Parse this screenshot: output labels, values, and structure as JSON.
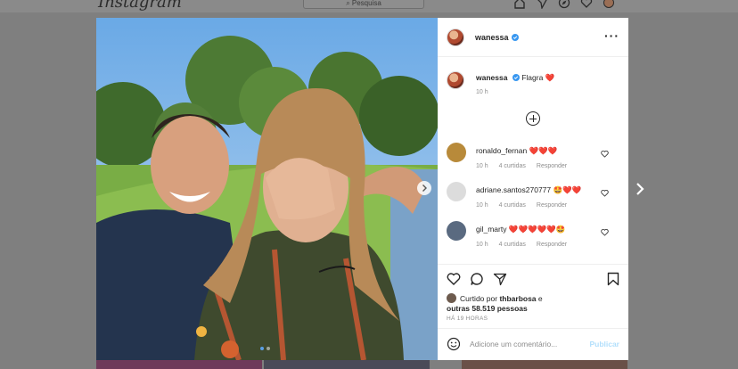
{
  "nav": {
    "logo": "Instagram",
    "search_placeholder": "Pesquisa"
  },
  "post": {
    "author": "wanessa",
    "caption": "Flagra",
    "caption_emoji": "❤️",
    "caption_time": "10 h",
    "liked_by_prefix": "Curtido por",
    "liked_by_user": "thbarbosa",
    "liked_by_connector": "e",
    "liked_by_others": "outras 58.519 pessoas",
    "posted_ago": "HÁ 19 HORAS",
    "add_comment_placeholder": "Adicione um comentário...",
    "publish_label": "Publicar"
  },
  "comments": [
    {
      "user": "ronaldo_fernan",
      "emojis": "❤️❤️❤️",
      "time": "10 h",
      "likes": "4 curtidas",
      "reply": "Responder",
      "avatar_color": "#b88a3a"
    },
    {
      "user": "adriane.santos270777",
      "emojis": "🤩❤️❤️",
      "time": "10 h",
      "likes": "4 curtidas",
      "reply": "Responder",
      "avatar_color": "#dcdcdc"
    },
    {
      "user": "gil_marty",
      "emojis": "❤️❤️❤️❤️❤️🤩",
      "time": "10 h",
      "likes": "4 curtidas",
      "reply": "Responder",
      "avatar_color": "#5a6a80"
    }
  ],
  "colors": {
    "backdrop": "#7f7f7f",
    "heart": "#e0245e",
    "verified": "#3897f0",
    "publish_disabled": "#b2dffc"
  }
}
